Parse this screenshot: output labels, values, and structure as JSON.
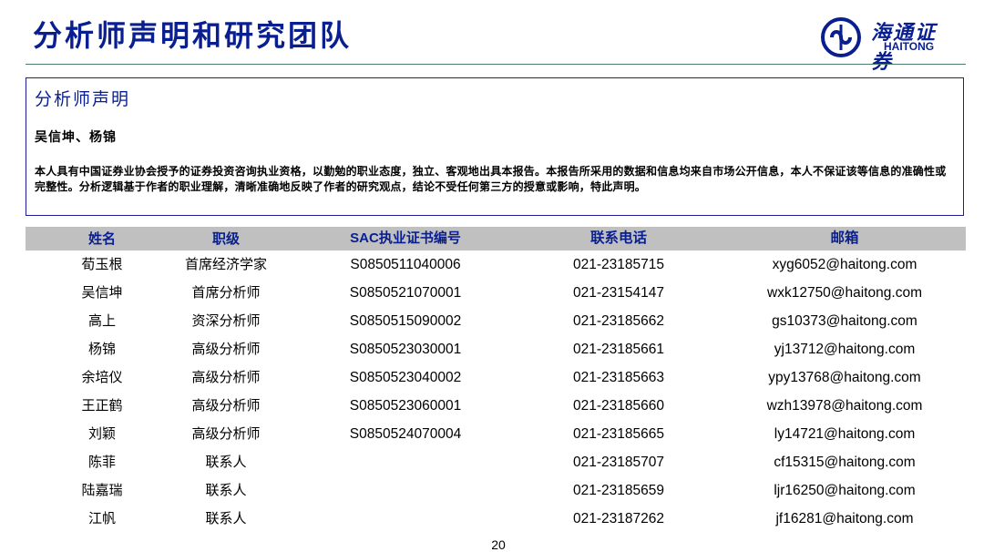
{
  "page": {
    "title": "分析师声明和研究团队",
    "page_number": "20"
  },
  "logo": {
    "cn": "海通证券",
    "en": "HAITONG",
    "color": "#0a1f8f"
  },
  "statement": {
    "heading": "分析师声明",
    "authors": "吴信坤、杨锦",
    "text": "本人具有中国证券业协会授予的证券投资咨询执业资格，以勤勉的职业态度，独立、客观地出具本报告。本报告所采用的数据和信息均来自市场公开信息，本人不保证该等信息的准确性或完整性。分析逻辑基于作者的职业理解，清晰准确地反映了作者的研究观点，结论不受任何第三方的授意或影响，特此声明。"
  },
  "table": {
    "headers": [
      "姓名",
      "职级",
      "SAC执业证书编号",
      "联系电话",
      "邮箱"
    ],
    "header_bg": "#c0c0c0",
    "rows": [
      {
        "name": "荀玉根",
        "rank": "首席经济学家",
        "sac": "S0850511040006",
        "tel": "021-23185715",
        "email": "xyg6052@haitong.com"
      },
      {
        "name": "吴信坤",
        "rank": "首席分析师",
        "sac": "S0850521070001",
        "tel": "021-23154147",
        "email": "wxk12750@haitong.com"
      },
      {
        "name": "高上",
        "rank": "资深分析师",
        "sac": "S0850515090002",
        "tel": "021-23185662",
        "email": "gs10373@haitong.com"
      },
      {
        "name": "杨锦",
        "rank": "高级分析师",
        "sac": "S0850523030001",
        "tel": "021-23185661",
        "email": "yj13712@haitong.com"
      },
      {
        "name": "余培仪",
        "rank": "高级分析师",
        "sac": "S0850523040002",
        "tel": "021-23185663",
        "email": "ypy13768@haitong.com"
      },
      {
        "name": "王正鹤",
        "rank": "高级分析师",
        "sac": "S0850523060001",
        "tel": "021-23185660",
        "email": "wzh13978@haitong.com"
      },
      {
        "name": "刘颖",
        "rank": "高级分析师",
        "sac": "S0850524070004",
        "tel": "021-23185665",
        "email": "ly14721@haitong.com"
      },
      {
        "name": "陈菲",
        "rank": "联系人",
        "sac": "",
        "tel": "021-23185707",
        "email": "cf15315@haitong.com"
      },
      {
        "name": "陆嘉瑞",
        "rank": "联系人",
        "sac": "",
        "tel": "021-23185659",
        "email": "ljr16250@haitong.com"
      },
      {
        "name": "江帆",
        "rank": "联系人",
        "sac": "",
        "tel": "021-23187262",
        "email": "jf16281@haitong.com"
      }
    ]
  }
}
